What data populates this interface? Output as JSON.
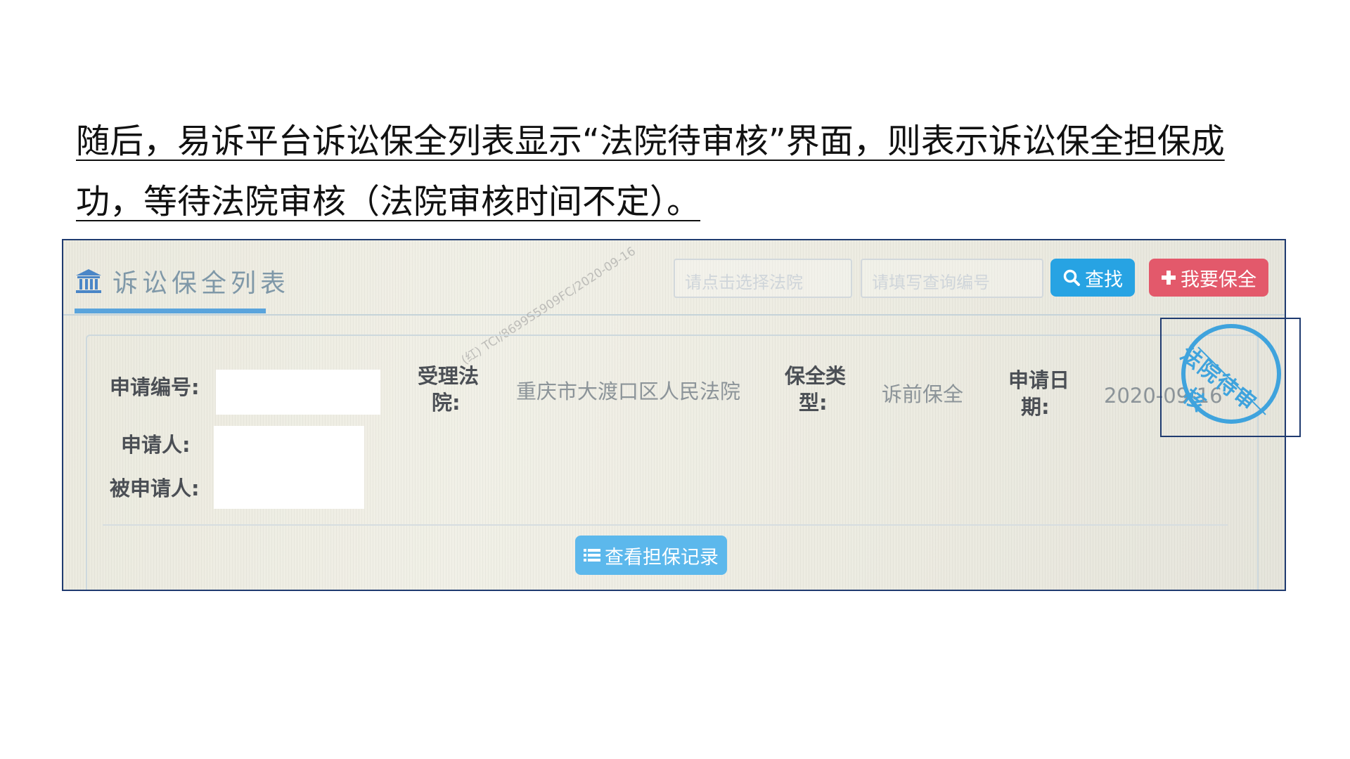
{
  "caption": "随后，易诉平台诉讼保全列表显示“法院待审核”界面，则表示诉讼保全担保成功，等待法院审核（法院审核时间不定）。",
  "panel": {
    "title": "诉讼保全列表",
    "court_placeholder": "请点击选择法院",
    "query_placeholder": "请填写查询编号",
    "search_label": "查找",
    "add_label": "我要保全",
    "watermark": "(红) TCI/8699S5909FC/2020-09-16"
  },
  "record": {
    "app_no_label": "申请编号:",
    "applicant_label": "申请人:",
    "respondent_label": "被申请人:",
    "court_label_1": "受理法",
    "court_label_2": "院:",
    "court_value": "重庆市大渡口区人民法院",
    "type_label_1": "保全类",
    "type_label_2": "型:",
    "type_value": "诉前保全",
    "date_label_1": "申请日",
    "date_label_2": "期:",
    "date_value": "2020-09-16",
    "view_records_label": "查看担保记录",
    "stamp_line1": "法院待审",
    "stamp_line2": "核"
  },
  "colors": {
    "search_button": "#27a3e3",
    "add_button": "#e3596b",
    "stamp": "#3fa3dd",
    "frame": "#1f3b70"
  }
}
